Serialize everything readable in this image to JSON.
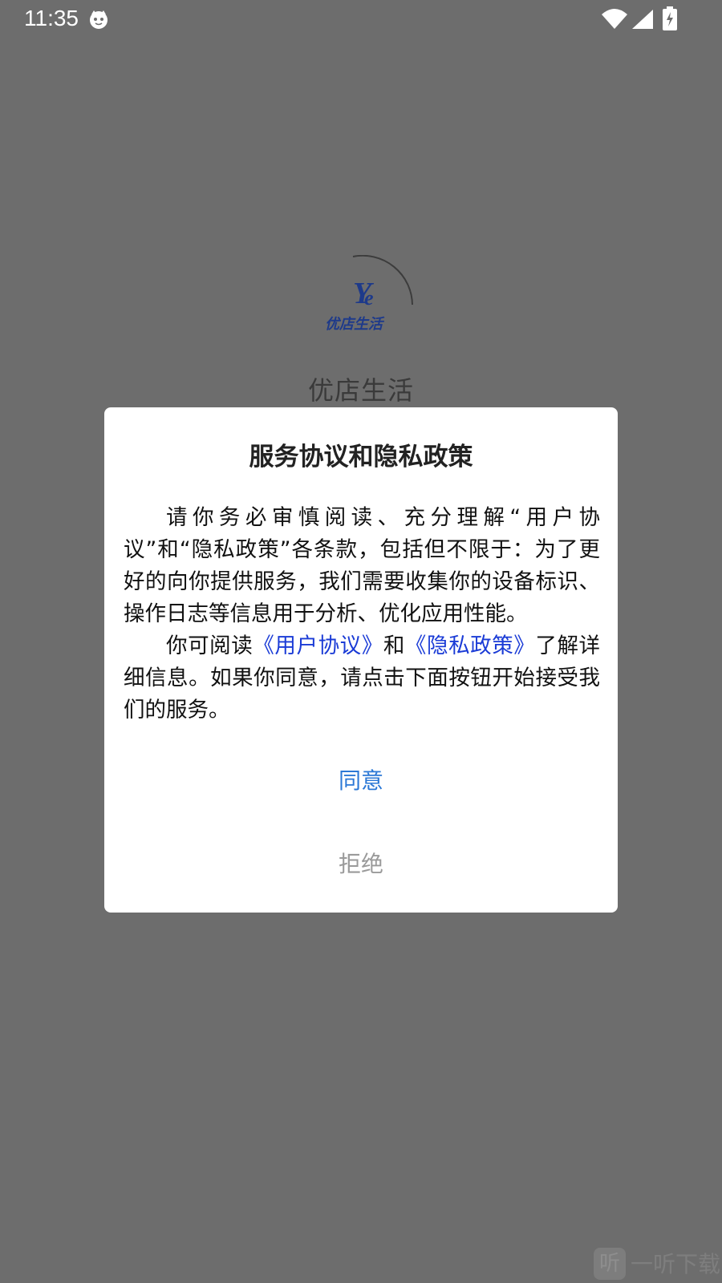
{
  "status_bar": {
    "time": "11:35",
    "icons": [
      "cat-notification-icon",
      "wifi-icon",
      "cellular-signal-icon",
      "battery-charging-icon"
    ]
  },
  "splash": {
    "logo_text": "优店生活",
    "app_name": "优店生活",
    "brand_color": "#1e3a8a"
  },
  "dialog": {
    "title": "服务协议和隐私政策",
    "paragraph1": "请你务必审慎阅读、充分理解“用户协议”和“隐私政策”各条款，包括但不限于：为了更好的向你提供服务，我们需要收集你的设备标识、操作日志等信息用于分析、优化应用性能。",
    "p2_prefix": "你可阅读",
    "user_agreement_link": "《用户协议》",
    "p2_and": "和",
    "privacy_policy_link": "《隐私政策》",
    "p2_suffix": "了解详细信息。如果你同意，请点击下面按钮开始接受我们的服务。",
    "agree_label": "同意",
    "reject_label": "拒绝"
  },
  "watermark": {
    "icon_char": "听",
    "text": "一听下载"
  },
  "colors": {
    "overlay_background": "#6d6d6d",
    "link": "#1a3bd6",
    "agree": "#2b78d6",
    "reject": "#9a9a9a"
  }
}
